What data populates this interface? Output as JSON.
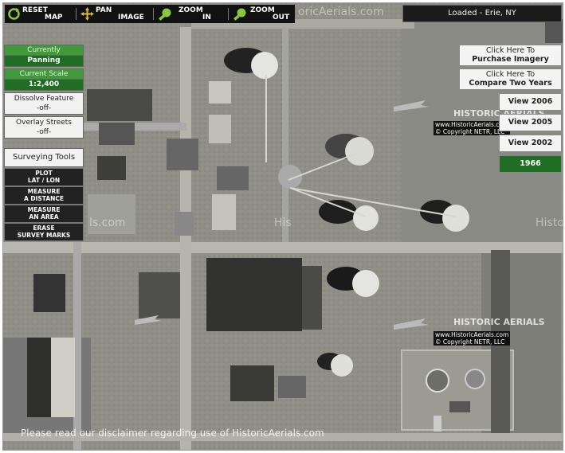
{
  "toolbar": {
    "reset": {
      "line1": "RESET",
      "line2": "MAP"
    },
    "pan": {
      "line1": "PAN",
      "line2": "IMAGE"
    },
    "zoom_in": {
      "line1": "ZOOM",
      "line2": "IN"
    },
    "zoom_out": {
      "line1": "ZOOM",
      "line2": "OUT"
    }
  },
  "status": "Loaded - Erie, NY",
  "left_panel": {
    "currently_label": "Currently",
    "currently_value": "Panning",
    "scale_label": "Current Scale",
    "scale_value": "1:2,400",
    "dissolve_label": "Dissolve Feature",
    "dissolve_value": "-off-",
    "overlay_label": "Overlay Streets",
    "overlay_value": "-off-",
    "surveying_label": "Surveying Tools",
    "tools": [
      {
        "line1": "PLOT",
        "line2": "LAT / LON"
      },
      {
        "line1": "MEASURE",
        "line2": "A DISTANCE"
      },
      {
        "line1": "MEASURE",
        "line2": "AN AREA"
      },
      {
        "line1": "ERASE",
        "line2": "SURVEY MARKS"
      }
    ]
  },
  "right_panel": {
    "purchase": {
      "line1": "Click Here To",
      "line2": "Purchase Imagery"
    },
    "compare": {
      "line1": "Click Here To",
      "line2": "Compare Two Years"
    },
    "views": [
      "View 2006",
      "View 2005",
      "View 2002",
      "1966"
    ],
    "active_view": "1966"
  },
  "watermarks": {
    "top": "oricAerials.com",
    "mid_left": "ls.com",
    "mid_center": "His",
    "right": "Histo",
    "historic_aerials": "HISTORIC AERIALS",
    "copyright_line1": "www.HistoricAerials.com",
    "copyright_line2": "© Copyright NETR, LLC"
  },
  "disclaimer": "Please read our disclaimer regarding use of HistoricAerials.com",
  "colors": {
    "accent_green": "#1f6e24",
    "toolbar_bg": "#111111"
  }
}
